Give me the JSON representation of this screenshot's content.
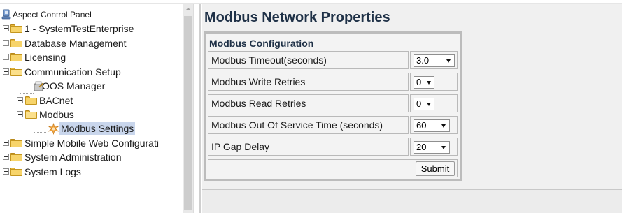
{
  "tree": {
    "root_label": "Aspect Control Panel",
    "items": [
      {
        "label": "1 - SystemTestEnterprise"
      },
      {
        "label": "Database Management"
      },
      {
        "label": "Licensing"
      },
      {
        "label": "Communication Setup"
      },
      {
        "label": "OOS Manager"
      },
      {
        "label": "BACnet"
      },
      {
        "label": "Modbus"
      },
      {
        "label": "Modbus Settings"
      },
      {
        "label": "Simple Mobile Web Configurati"
      },
      {
        "label": "System Administration"
      },
      {
        "label": "System Logs"
      }
    ]
  },
  "page": {
    "title": "Modbus Network Properties",
    "section_title": "Modbus Configuration",
    "rows": [
      {
        "label": "Modbus Timeout(seconds)",
        "value": "3.0"
      },
      {
        "label": "Modbus Write Retries",
        "value": "0"
      },
      {
        "label": "Modbus Read Retries",
        "value": "0"
      },
      {
        "label": "Modbus Out Of Service Time (seconds)",
        "value": "60"
      },
      {
        "label": "IP Gap Delay",
        "value": "20"
      }
    ],
    "submit_label": "Submit"
  },
  "icons": {
    "root": "network-panel-icon",
    "folder": "folder-icon",
    "oos": "oos-manager-icon",
    "settings": "gear-star-icon",
    "dropdown": "chevron-down-icon"
  },
  "colors": {
    "title": "#1f3147",
    "selection": "#c9d6ec",
    "folder": "#f7d46a"
  }
}
